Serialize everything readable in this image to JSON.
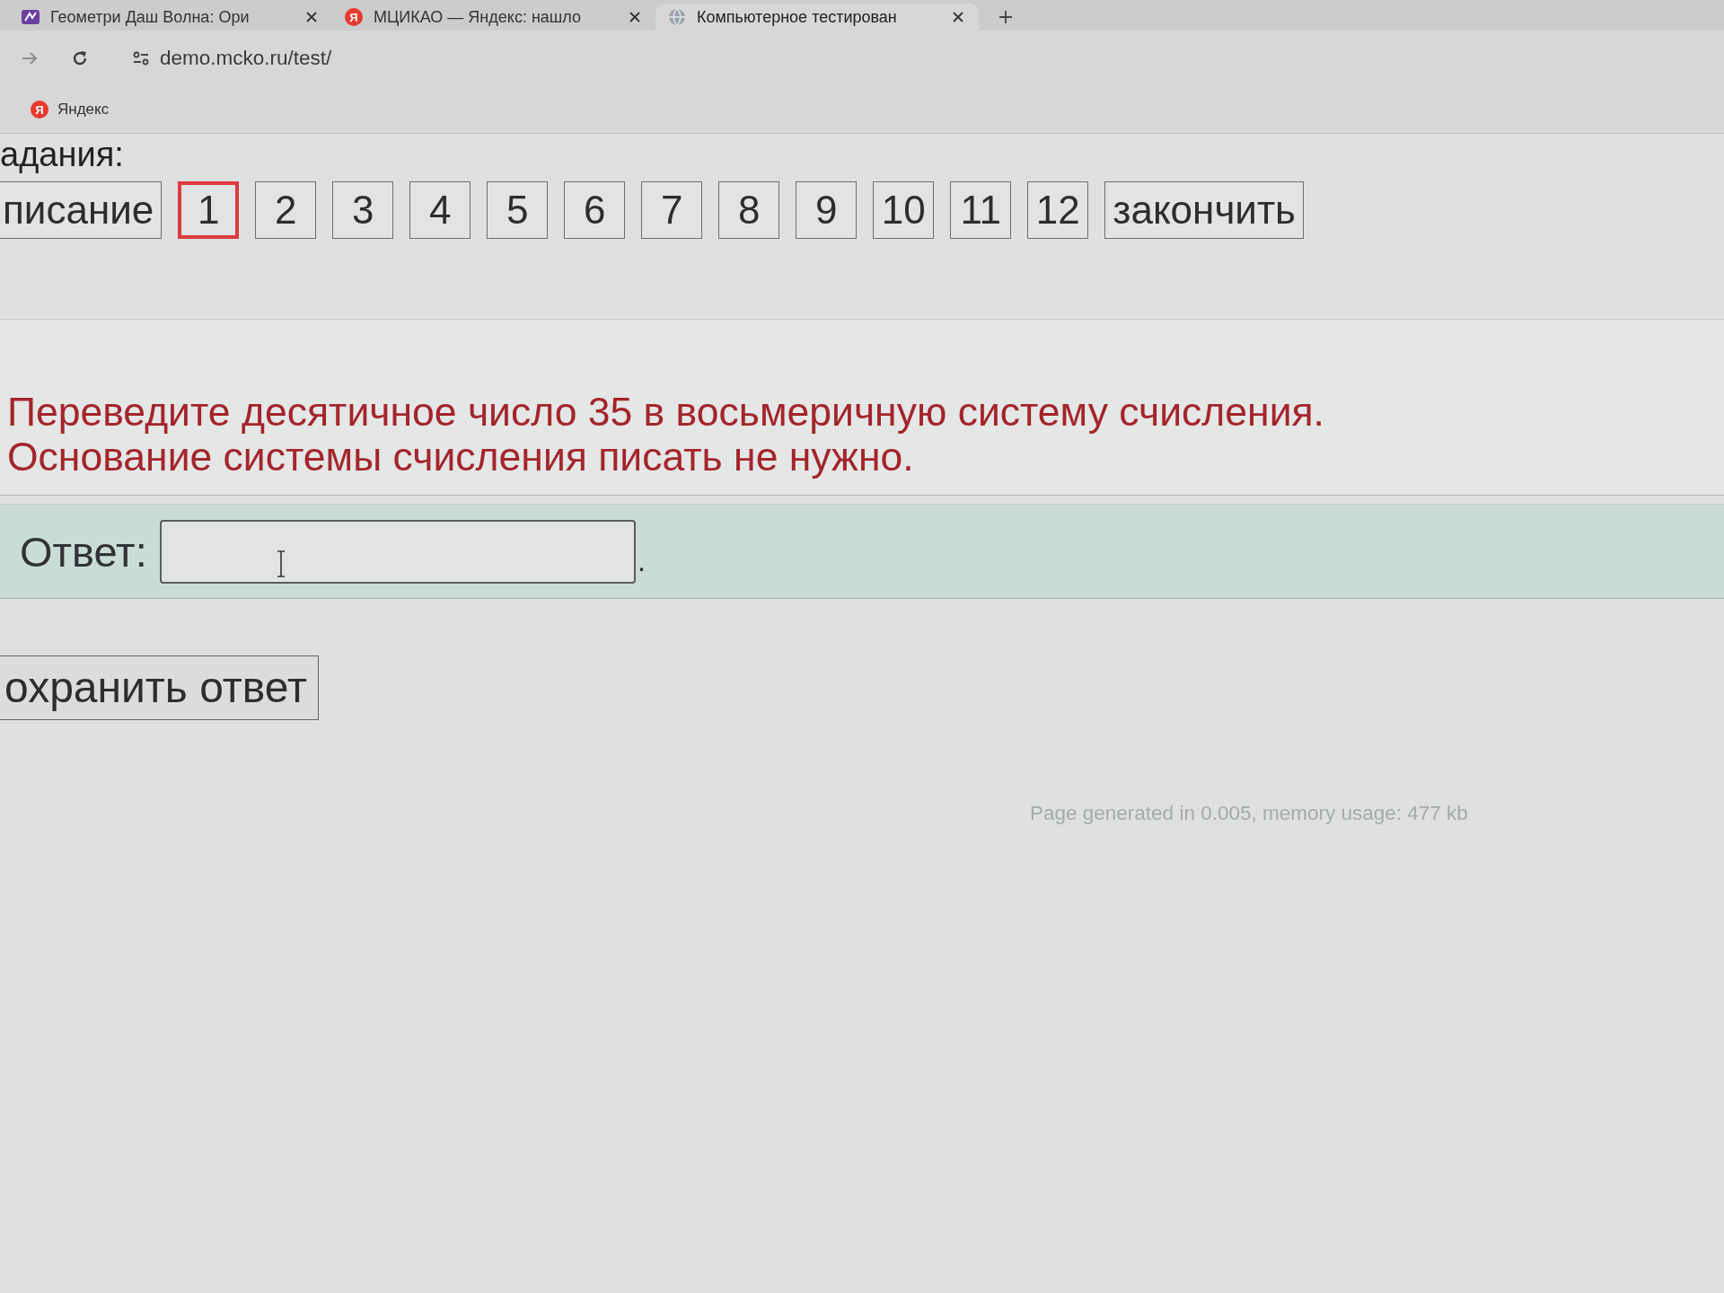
{
  "browser": {
    "tabs": [
      {
        "title": "Геометри Даш Волна: Ори",
        "kind": "tile",
        "selected": false
      },
      {
        "title": "МЦИКАО — Яндекс: нашло",
        "kind": "disc",
        "glyph": "Я",
        "selected": false
      },
      {
        "title": "Компьютерное тестирован",
        "kind": "globe",
        "selected": true
      }
    ],
    "address": "demo.mcko.ru/test/",
    "bookmarks": [
      {
        "label": "Яндекс",
        "glyph": "Я"
      }
    ]
  },
  "page": {
    "tasks_label": "адания:",
    "task_nav": [
      {
        "label": "писание",
        "kind": "section",
        "selected": false
      },
      {
        "label": "1",
        "kind": "task",
        "selected": true
      },
      {
        "label": "2",
        "kind": "task",
        "selected": false
      },
      {
        "label": "3",
        "kind": "task",
        "selected": false
      },
      {
        "label": "4",
        "kind": "task",
        "selected": false
      },
      {
        "label": "5",
        "kind": "task",
        "selected": false
      },
      {
        "label": "6",
        "kind": "task",
        "selected": false
      },
      {
        "label": "7",
        "kind": "task",
        "selected": false
      },
      {
        "label": "8",
        "kind": "task",
        "selected": false
      },
      {
        "label": "9",
        "kind": "task",
        "selected": false
      },
      {
        "label": "10",
        "kind": "task",
        "selected": false
      },
      {
        "label": "11",
        "kind": "task",
        "selected": false
      },
      {
        "label": "12",
        "kind": "task",
        "selected": false
      },
      {
        "label": "закончить",
        "kind": "finish",
        "selected": false
      }
    ],
    "question": [
      "Переведите десятичное число 35 в восьмеричную систему счисления.",
      "Основание системы счисления писать не нужно."
    ],
    "answer": {
      "label": "Ответ:",
      "suffix": "."
    },
    "save_button": "охранить ответ",
    "footer": "Page generated in 0.005, memory usage: 477 kb"
  }
}
